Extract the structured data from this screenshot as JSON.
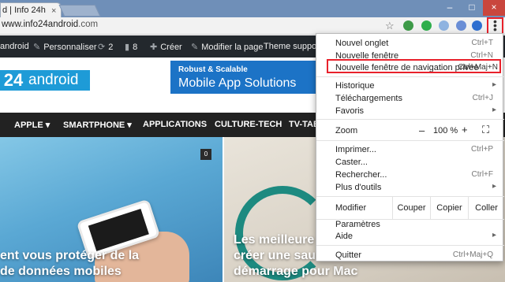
{
  "browser": {
    "tab_title": "d | Info 24h",
    "tab_close": "×",
    "win_min": "–",
    "win_max": "□",
    "win_close": "×",
    "url_host": "www.info24android",
    "url_tld": ".com",
    "star": "☆",
    "menu_icon": "⋮"
  },
  "adminbar": {
    "site": "android",
    "customize": "Personnaliser",
    "updates_count": "2",
    "comments_count": "8",
    "new": "Créer",
    "edit": "Modifier la page",
    "theme": "Theme support"
  },
  "header": {
    "logo_number": "24",
    "logo_text": "android",
    "banner_line1": "Robust & Scalable",
    "banner_line2": "Mobile App Solutions"
  },
  "nav": {
    "items": [
      "APPLE",
      "SMARTPHONE",
      "APPLICATIONS",
      "CULTURE-TECH",
      "TV-TAB"
    ],
    "dropdown_arrow": "▾"
  },
  "content": {
    "left_title_line1": "ent vous protéger de la",
    "left_title_line2": "de données mobiles",
    "comment_badge": "0",
    "right_title_line1": "Les meilleure",
    "right_title_line2": "créer une sau",
    "right_title_line3": "démarrage pour Mac"
  },
  "menu": {
    "new_tab": "Nouvel onglet",
    "new_tab_sc": "Ctrl+T",
    "new_window": "Nouvelle fenêtre",
    "new_window_sc": "Ctrl+N",
    "incognito": "Nouvelle fenêtre de navigation privée",
    "incognito_sc": "Ctrl+Maj+N",
    "history": "Historique",
    "downloads": "Téléchargements",
    "downloads_sc": "Ctrl+J",
    "bookmarks": "Favoris",
    "zoom": "Zoom",
    "zoom_minus": "–",
    "zoom_value": "100 %",
    "zoom_plus": "+",
    "fullscreen": "⛶",
    "print": "Imprimer...",
    "print_sc": "Ctrl+P",
    "cast": "Caster...",
    "find": "Rechercher...",
    "find_sc": "Ctrl+F",
    "more_tools": "Plus d'outils",
    "edit": "Modifier",
    "cut": "Couper",
    "copy": "Copier",
    "paste": "Coller",
    "settings": "Paramètres",
    "help": "Aide",
    "quit": "Quitter",
    "quit_sc": "Ctrl+Maj+Q",
    "submenu_arrow": "▸"
  },
  "colors": {
    "highlight_red": "#e8212b",
    "logo_blue": "#1e9bd7",
    "admin_bar": "#23282d",
    "nav_bar": "#222222"
  },
  "icons": [
    "close-icon",
    "star-icon",
    "kebab-menu-icon",
    "brush-icon",
    "refresh-icon",
    "comment-icon",
    "plus-icon",
    "fullscreen-icon",
    "submenu-arrow-icon"
  ]
}
